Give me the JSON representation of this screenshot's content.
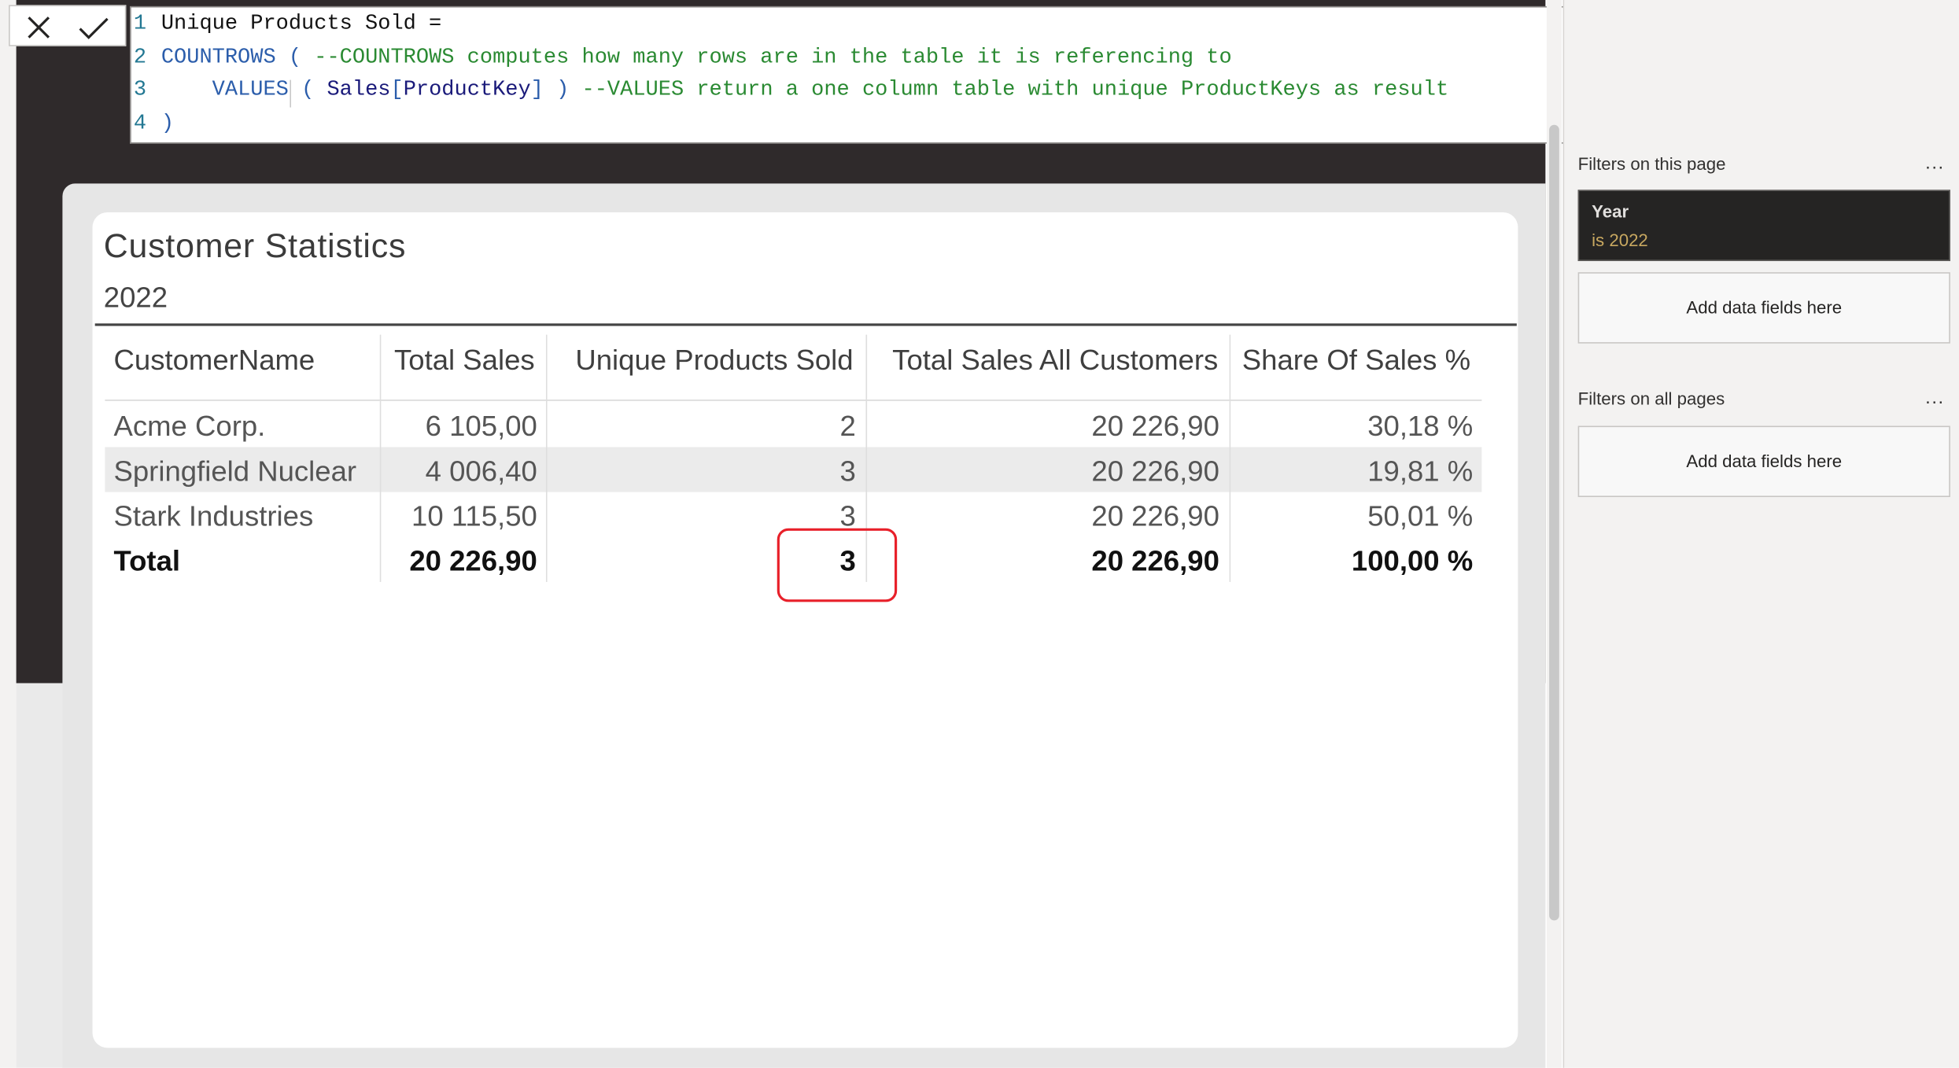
{
  "formula_bar": {
    "cancel_icon": "close-icon",
    "commit_icon": "checkmark-icon",
    "lines": [
      {
        "num": "1",
        "parts": [
          {
            "cls": "tx",
            "text": "Unique Products Sold ="
          }
        ]
      },
      {
        "num": "2",
        "parts": [
          {
            "cls": "kw",
            "text": "COUNTROWS"
          },
          {
            "cls": "kw",
            "text": " ( "
          },
          {
            "cls": "cm",
            "text": "--COUNTROWS computes how many rows are in the table it is referencing to"
          }
        ]
      },
      {
        "num": "3",
        "parts": [
          {
            "cls": "tx",
            "text": "    "
          },
          {
            "cls": "kw",
            "text": "VALUES"
          },
          {
            "cls": "kw",
            "text": " ( "
          },
          {
            "cls": "id",
            "text": "Sales"
          },
          {
            "cls": "kw",
            "text": "["
          },
          {
            "cls": "id",
            "text": "ProductKey"
          },
          {
            "cls": "kw",
            "text": "]"
          },
          {
            "cls": "kw",
            "text": " ) "
          },
          {
            "cls": "cm",
            "text": "--VALUES return a one column table with unique ProductKeys as result"
          }
        ]
      },
      {
        "num": "4",
        "parts": [
          {
            "cls": "kw",
            "text": ")"
          }
        ]
      }
    ]
  },
  "visual": {
    "title": "Customer Statistics",
    "subtitle": "2022",
    "columns": [
      "CustomerName",
      "Total Sales",
      "Unique Products Sold",
      "Total Sales All Customers",
      "Share Of Sales %"
    ],
    "rows": [
      [
        "Acme Corp.",
        "6 105,00",
        "2",
        "20 226,90",
        "30,18 %"
      ],
      [
        "Springfield Nuclear",
        "4 006,40",
        "3",
        "20 226,90",
        "19,81 %"
      ],
      [
        "Stark Industries",
        "10 115,50",
        "3",
        "20 226,90",
        "50,01 %"
      ]
    ],
    "total_row": [
      "Total",
      "20 226,90",
      "3",
      "20 226,90",
      "100,00 %"
    ]
  },
  "filters": {
    "this_page_heading": "Filters on this page",
    "all_pages_heading": "Filters on all pages",
    "more_label": "...",
    "year_filter": {
      "title": "Year",
      "value": "is 2022"
    },
    "add_fields_label": "Add data fields here"
  },
  "colors": {
    "highlight": "#e8202a",
    "filter_value": "#c8a860",
    "comment": "#2a8a32",
    "keyword": "#2b5dab"
  }
}
